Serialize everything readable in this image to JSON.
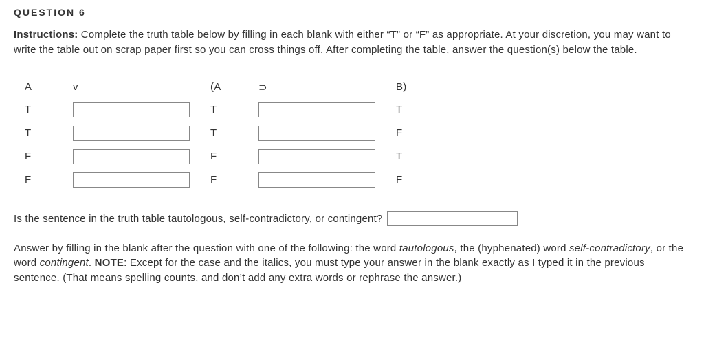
{
  "question_number": "QUESTION 6",
  "instructions_label": "Instructions:",
  "instructions_text": " Complete the truth table below by filling in each blank with either “T” or “F” as appropriate. At your discretion, you may want to write the table out on scrap paper first so you can cross things off. After completing the table, answer the question(s) below the table.",
  "headers": {
    "A": "A",
    "v": "v",
    "pA": "(A",
    "imp": "⊃",
    "B": "B)"
  },
  "rows": [
    {
      "A": "T",
      "v": "",
      "pA": "T",
      "imp": "",
      "B": "T"
    },
    {
      "A": "T",
      "v": "",
      "pA": "T",
      "imp": "",
      "B": "F"
    },
    {
      "A": "F",
      "v": "",
      "pA": "F",
      "imp": "",
      "B": "T"
    },
    {
      "A": "F",
      "v": "",
      "pA": "F",
      "imp": "",
      "B": "F"
    }
  ],
  "followup_question": "Is the sentence in the truth table tautologous, self-contradictory, or contingent?",
  "followup_value": "",
  "note_prefix": "Answer by filling in the blank after the question with one of the following: the word ",
  "w_taut": "tautologous",
  "note_mid1": ", the (hyphenated) word ",
  "w_self": "self-contradictory",
  "note_mid2": ", or the word ",
  "w_cont": "contingent",
  "note_period": ". ",
  "note_label": "NOTE",
  "note_rest": ": Except for the case and the italics, you must type your answer in the blank exactly as I typed it in the previous sentence. (That means spelling counts, and don’t add any extra words or rephrase the answer.)"
}
